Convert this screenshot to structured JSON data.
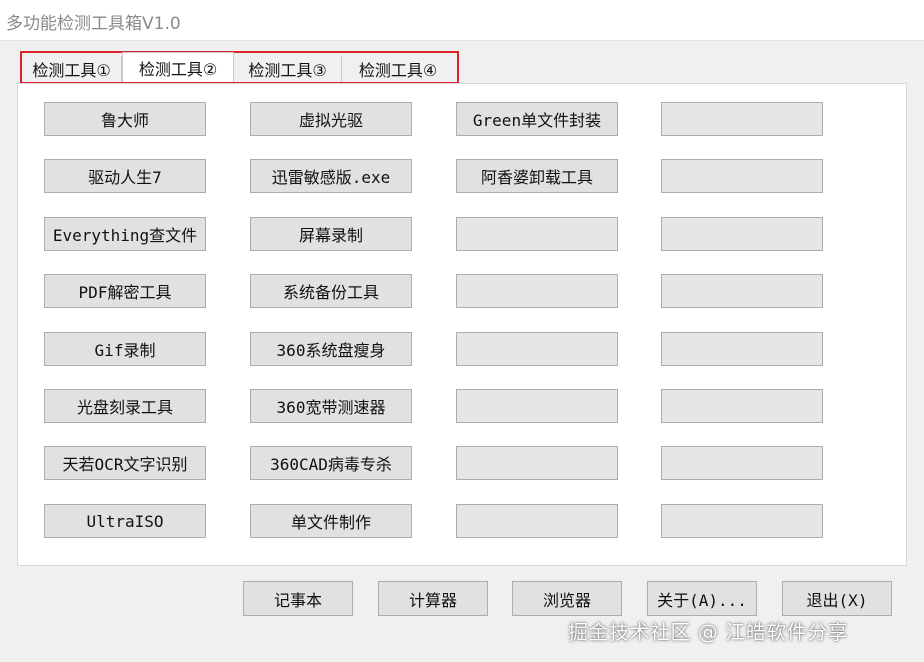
{
  "window": {
    "title": "多功能检测工具箱V1.0"
  },
  "tabs": [
    {
      "label": "检测工具①",
      "active": false
    },
    {
      "label": "检测工具②",
      "active": true
    },
    {
      "label": "检测工具③",
      "active": false
    },
    {
      "label": "检测工具④",
      "active": false
    }
  ],
  "grid": {
    "columns": [
      [
        "鲁大师",
        "驱动人生7",
        "Everything查文件",
        "PDF解密工具",
        "Gif录制",
        "光盘刻录工具",
        "天若OCR文字识别",
        "UltraISO"
      ],
      [
        "虚拟光驱",
        "迅雷敏感版.exe",
        "屏幕录制",
        "系统备份工具",
        "360系统盘瘦身",
        "360宽带测速器",
        "360CAD病毒专杀",
        "单文件制作"
      ],
      [
        "Green单文件封装",
        "阿香婆卸载工具",
        "",
        "",
        "",
        "",
        "",
        ""
      ],
      [
        "",
        "",
        "",
        "",
        "",
        "",
        "",
        ""
      ]
    ]
  },
  "bottom_buttons": [
    "记事本",
    "计算器",
    "浏览器",
    "关于(A)...",
    "退出(X)"
  ],
  "watermark": "掘金技术社区 @ 江皓软件分享",
  "colors": {
    "highlight_box": "#d9232d",
    "button_face": "#e1e1e1",
    "panel": "#ffffff"
  }
}
